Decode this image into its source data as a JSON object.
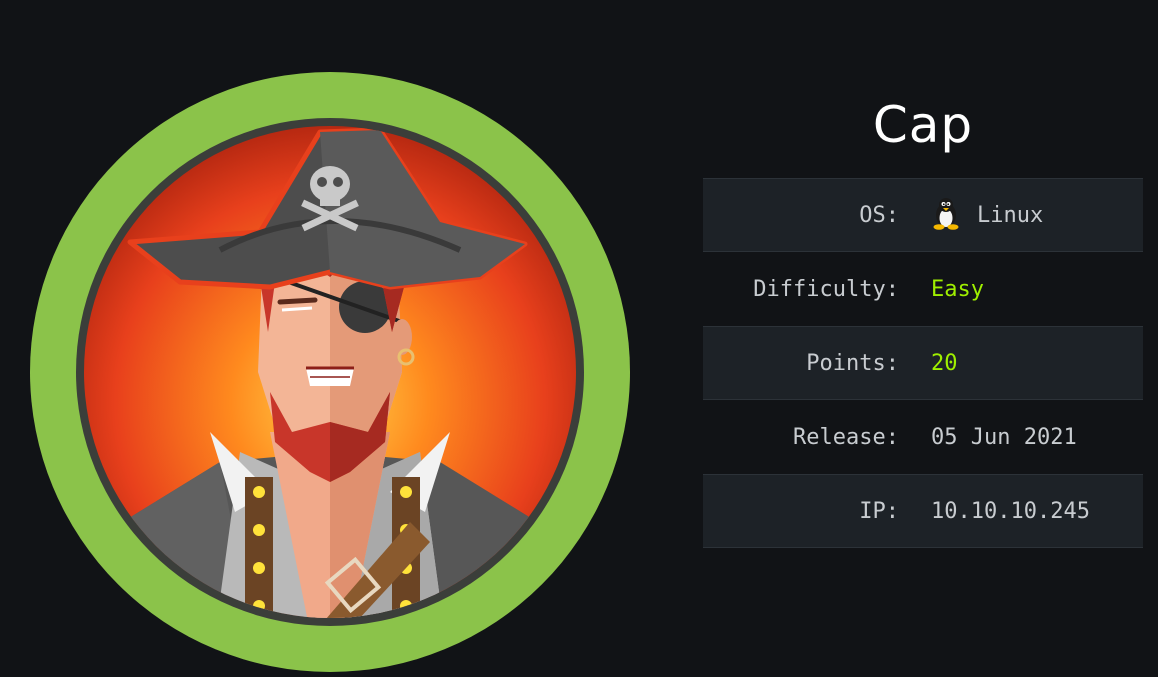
{
  "machine": {
    "name": "Cap"
  },
  "info": [
    {
      "label": "OS:",
      "value": "Linux",
      "icon": "linux-icon",
      "accent": false
    },
    {
      "label": "Difficulty:",
      "value": "Easy",
      "accent": true
    },
    {
      "label": "Points:",
      "value": "20",
      "accent": true
    },
    {
      "label": "Release:",
      "value": "05 Jun 2021",
      "accent": false
    },
    {
      "label": "IP:",
      "value": "10.10.10.245",
      "accent": false
    }
  ],
  "colors": {
    "background": "#111316",
    "ring": "#8bc34a",
    "accent": "#9fef00",
    "row_shade": "#1d2227",
    "text": "#c8ccd0"
  }
}
